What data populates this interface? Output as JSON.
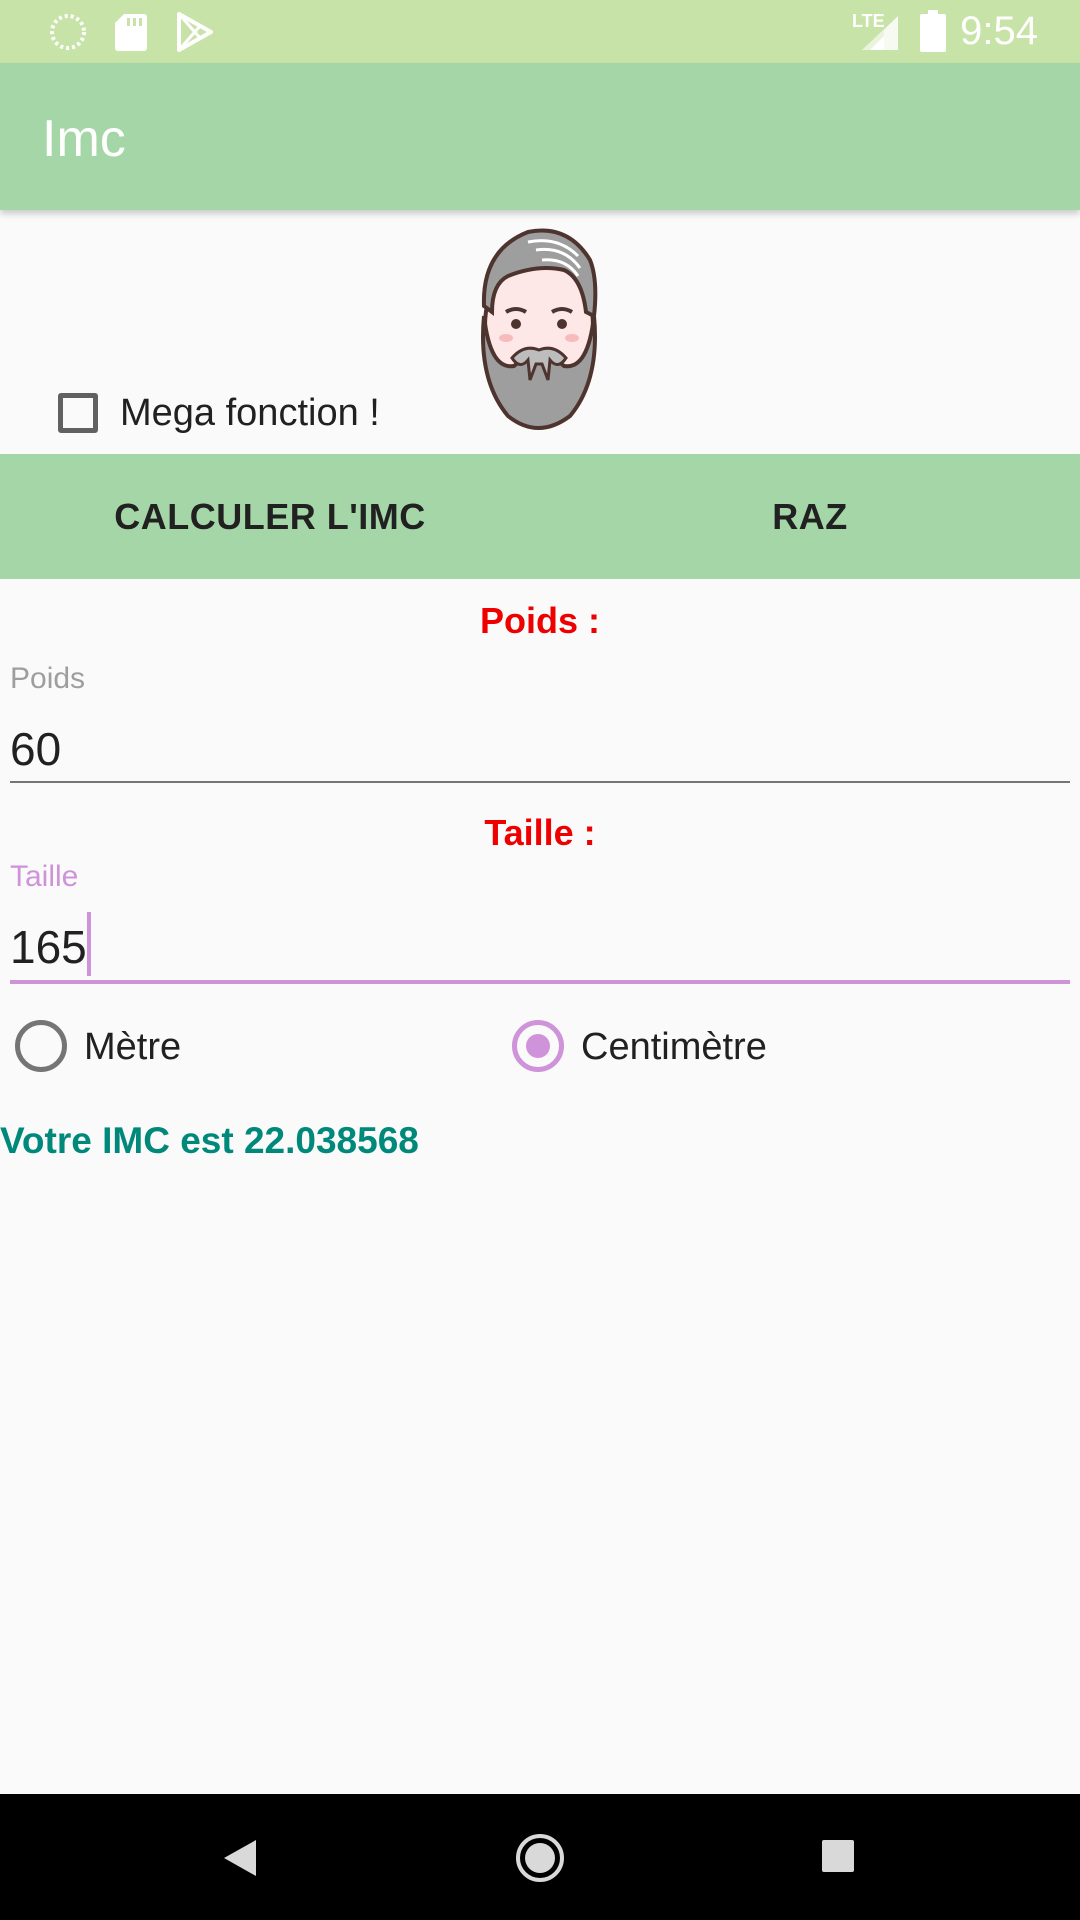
{
  "status_bar": {
    "time": "9:54",
    "network": "LTE",
    "left_icons": [
      "sync-icon",
      "sd-card-icon",
      "play-store-icon"
    ],
    "right_icons": [
      "signal-icon",
      "battery-icon"
    ]
  },
  "app_bar": {
    "title": "Imc"
  },
  "checkbox": {
    "label": "Mega fonction !",
    "checked": false
  },
  "buttons": {
    "calculate": "CALCULER L'IMC",
    "reset": "RAZ"
  },
  "weight": {
    "section_label": "Poids :",
    "hint": "Poids",
    "value": "60"
  },
  "height": {
    "section_label": "Taille :",
    "hint": "Taille",
    "value": "165",
    "focused": true
  },
  "units": {
    "options": [
      "Mètre",
      "Centimètre"
    ],
    "selected": "Centimètre"
  },
  "result": {
    "text": "Votre IMC est 22.038568"
  },
  "colors": {
    "status_bar": "#c8e3a7",
    "app_bar": "#a5d6a7",
    "accent": "#ce93d8",
    "label_red": "#ee0000",
    "result_teal": "#00897b"
  },
  "nav_bar": {
    "icons": [
      "back-icon",
      "home-icon",
      "recents-icon"
    ]
  }
}
